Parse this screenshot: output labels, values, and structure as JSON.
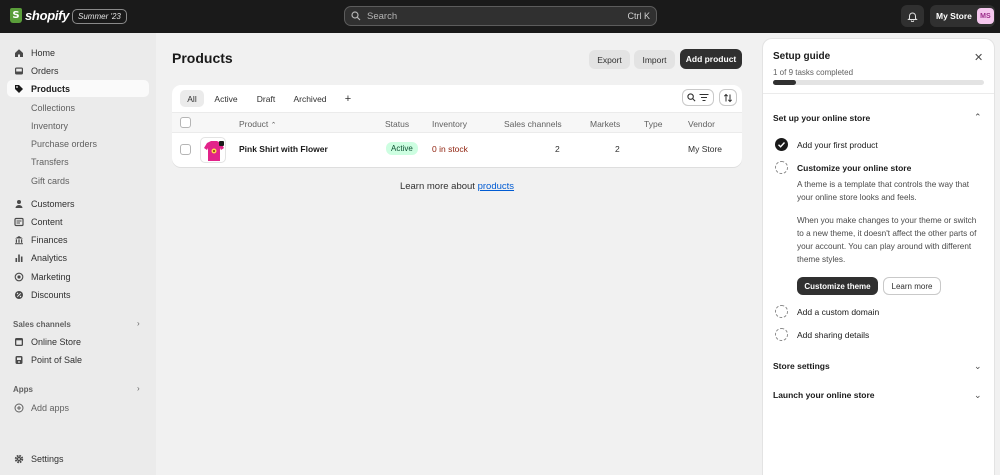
{
  "topbar": {
    "brand": "shopify",
    "edition_badge": "Summer '23",
    "search_placeholder": "Search",
    "search_shortcut": "Ctrl K",
    "store_name": "My Store",
    "avatar_initials": "MS"
  },
  "sidebar": {
    "items": [
      {
        "label": "Home",
        "icon": "home-icon"
      },
      {
        "label": "Orders",
        "icon": "inbox-icon"
      },
      {
        "label": "Products",
        "icon": "tag-icon",
        "active": true
      }
    ],
    "product_subitems": [
      "Collections",
      "Inventory",
      "Purchase orders",
      "Transfers",
      "Gift cards"
    ],
    "items2": [
      {
        "label": "Customers",
        "icon": "person-icon"
      },
      {
        "label": "Content",
        "icon": "content-icon"
      },
      {
        "label": "Finances",
        "icon": "bank-icon"
      },
      {
        "label": "Analytics",
        "icon": "bar-chart-icon"
      },
      {
        "label": "Marketing",
        "icon": "target-icon"
      },
      {
        "label": "Discounts",
        "icon": "discount-icon"
      }
    ],
    "sales_channels_label": "Sales channels",
    "channels": [
      {
        "label": "Online Store",
        "icon": "store-icon"
      },
      {
        "label": "Point of Sale",
        "icon": "pos-icon"
      }
    ],
    "apps_label": "Apps",
    "add_apps": "Add apps",
    "settings": "Settings"
  },
  "main": {
    "title": "Products",
    "export": "Export",
    "import": "Import",
    "add_product": "Add product",
    "tabs": [
      "All",
      "Active",
      "Draft",
      "Archived",
      "+"
    ],
    "columns": [
      "Product",
      "Status",
      "Inventory",
      "Sales channels",
      "Markets",
      "Type",
      "Vendor"
    ],
    "rows": [
      {
        "product": "Pink Shirt with Flower",
        "status": "Active",
        "inventory": "0 in stock",
        "sales_channels": "2",
        "markets": "2",
        "type": "",
        "vendor": "My Store"
      }
    ],
    "learn_prefix": "Learn more about ",
    "learn_link": "products"
  },
  "setup": {
    "title": "Setup guide",
    "progress_text": "1 of 9 tasks completed",
    "progress": 0.11,
    "section_online": "Set up your online store",
    "tasks": [
      {
        "label": "Add your first product",
        "done": true
      },
      {
        "label": "Customize your online store",
        "done": false
      },
      {
        "label": "Add a custom domain",
        "done": false
      },
      {
        "label": "Add sharing details",
        "done": false
      }
    ],
    "desc1": "A theme is a template that controls the way that your online store looks and feels.",
    "desc2": "When you make changes to your theme or switch to a new theme, it doesn't affect the other parts of your account. You can play around with different theme styles.",
    "customize_btn": "Customize theme",
    "learn_btn": "Learn more",
    "section_settings": "Store settings",
    "section_launch": "Launch your online store"
  },
  "colors": {
    "topbar_bg": "#1a1a1a",
    "primary_button": "#303030",
    "active_badge_bg": "#cdfee1",
    "inventory_warning": "#8e1f0b",
    "link": "#005bd3"
  }
}
